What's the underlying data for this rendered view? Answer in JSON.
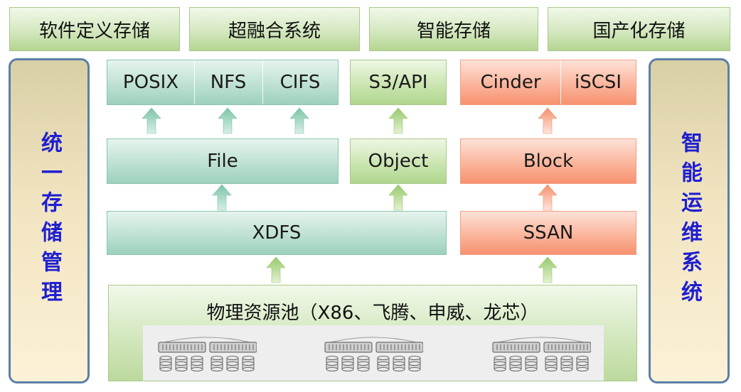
{
  "top_categories": [
    "软件定义存储",
    "超融合系统",
    "智能存储",
    "国产化存储"
  ],
  "left_panel": {
    "title": "统一存储管理"
  },
  "right_panel": {
    "title": "智能运维系统"
  },
  "protocols": {
    "file": [
      "POSIX",
      "NFS",
      "CIFS"
    ],
    "object": "S3/API",
    "block": [
      "Cinder",
      "iSCSI"
    ]
  },
  "interfaces": {
    "file": "File",
    "object": "Object",
    "block": "Block"
  },
  "engines": {
    "xdfs": "XDFS",
    "ssan": "SSAN"
  },
  "resource_pool": {
    "title": "物理资源池（X86、飞腾、申威、龙芯）"
  },
  "colors": {
    "teal": "#9dd1bd",
    "green": "#b0d68e",
    "orange": "#f7916f",
    "side_text": "#1f1fd0",
    "side_border": "#5b7fa6"
  }
}
